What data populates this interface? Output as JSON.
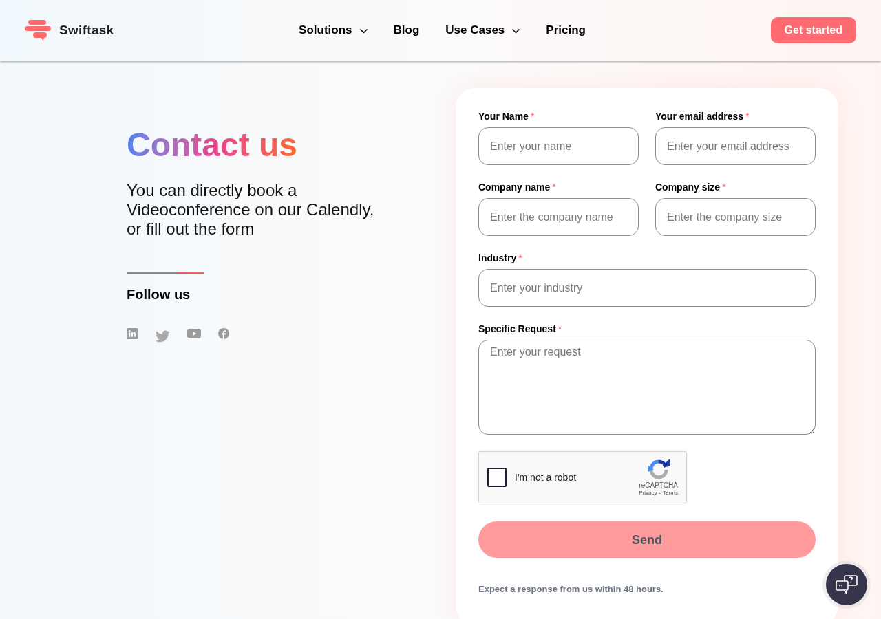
{
  "header": {
    "logo_text": "Swiftask",
    "nav": [
      {
        "label": "Solutions",
        "kind": "dropdown"
      },
      {
        "label": "Blog",
        "kind": "link"
      },
      {
        "label": "Use Cases",
        "kind": "dropdown"
      },
      {
        "label": "Pricing",
        "kind": "link"
      }
    ],
    "cta": "Get started"
  },
  "intro": {
    "title": "Contact us",
    "text": "You can directly book a Videoconference on our Calendly, or fill out the form",
    "follow_title": "Follow us"
  },
  "form": {
    "rows": [
      {
        "fields": [
          {
            "label": "Your Name",
            "required_mark": "*",
            "placeholder": "Enter your name",
            "kind": "input"
          },
          {
            "label": "Your email address",
            "required_mark": "*",
            "placeholder": "Enter your email address",
            "kind": "input"
          }
        ]
      },
      {
        "fields": [
          {
            "label": "Company name",
            "required_mark": "*",
            "placeholder": "Enter the company name",
            "kind": "input"
          },
          {
            "label": "Company size",
            "required_mark": "*",
            "placeholder": "Enter the company size",
            "kind": "input"
          }
        ]
      },
      {
        "fields": [
          {
            "label": "Industry",
            "required_mark": "*",
            "placeholder": "Enter your industry",
            "kind": "input"
          }
        ]
      },
      {
        "fields": [
          {
            "label": "Specific Request",
            "required_mark": "*",
            "placeholder": "Enter your request",
            "kind": "textarea"
          }
        ]
      }
    ],
    "captcha": {
      "label": "I'm not a robot",
      "checked": false,
      "brand": "reCAPTCHA",
      "privacy": "Privacy",
      "separator": "-",
      "terms": "Terms"
    },
    "submit": "Send",
    "note": "Expect a response from us within 48 hours."
  }
}
